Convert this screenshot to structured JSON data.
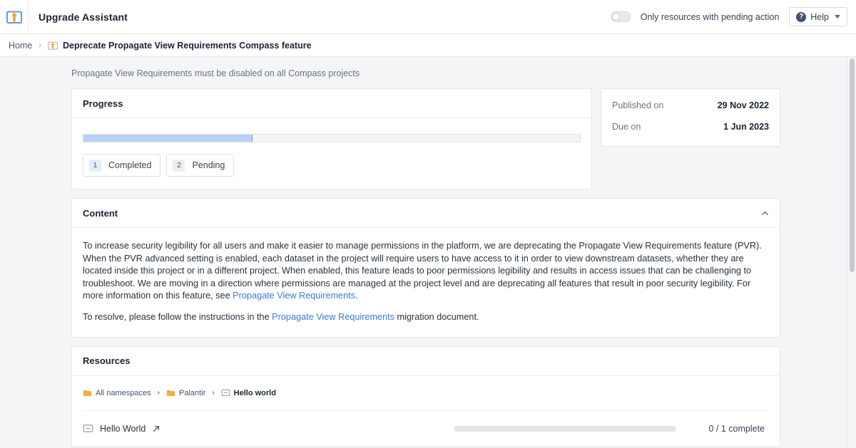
{
  "appbar": {
    "logo_icon": "upgrade-arrow-icon",
    "title": "Upgrade Assistant",
    "toggle_label": "Only resources with pending action",
    "toggle_on": false,
    "help_label": "Help",
    "help_icon": "question-circle-icon",
    "caret_icon": "chevron-down-icon"
  },
  "breadcrumb": {
    "home": "Home",
    "separator": "›",
    "current": "Deprecate Propagate View Requirements Compass feature",
    "current_icon": "upgrade-arrow-icon"
  },
  "page": {
    "subtitle": "Propagate View Requirements must be disabled on all Compass projects"
  },
  "progress": {
    "title": "Progress",
    "percent_complete": 34,
    "pills": [
      {
        "count": "1",
        "label": "Completed",
        "style": "blue"
      },
      {
        "count": "2",
        "label": "Pending",
        "style": "gray"
      }
    ]
  },
  "meta": {
    "rows": [
      {
        "key": "Published on",
        "value": "29 Nov 2022"
      },
      {
        "key": "Due on",
        "value": "1 Jun 2023"
      }
    ]
  },
  "content": {
    "title": "Content",
    "collapse_icon": "chevron-up-icon",
    "paragraph_1_part_1": "To increase security legibility for all users and make it easier to manage permissions in the platform, we are deprecating the Propagate View Requirements feature (PVR). When the PVR advanced setting is enabled, each dataset in the project will require users to have access to it in order to view downstream datasets, whether they are located inside this project or in a different project. When enabled, this feature leads to poor permissions legibility and results in access issues that can be challenging to troubleshoot. We are moving in a direction where permissions are managed at the project level and are deprecating all features that result in poor security legibility. For more information on this feature, see ",
    "paragraph_1_link": "Propagate View Requirements",
    "paragraph_1_part_2": ".",
    "paragraph_2_part_1": "To resolve, please follow the instructions in the ",
    "paragraph_2_link": "Propagate View Requirements",
    "paragraph_2_part_2": " migration document."
  },
  "resources": {
    "title": "Resources",
    "breadcrumbs": [
      {
        "label": "All namespaces",
        "icon": "folder-icon"
      },
      {
        "label": "Palantir",
        "icon": "folder-icon"
      },
      {
        "label": "Hello world",
        "icon": "project-icon"
      }
    ],
    "breadcrumb_separator": "›",
    "rows": [
      {
        "name": "Hello World",
        "icon": "project-icon",
        "external_link_icon": "external-link-icon",
        "progress_percent": 0,
        "status": "0 / 1 complete"
      }
    ]
  },
  "colors": {
    "page_background": "#f4f5f7",
    "card_background": "#ffffff",
    "link": "#3a7bd8",
    "progress_fill": "#b7d1f5",
    "folder_icon": "#f2a228"
  }
}
